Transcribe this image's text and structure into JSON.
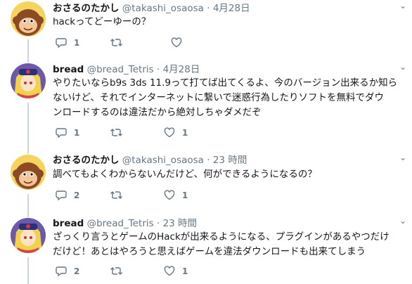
{
  "tweets": [
    {
      "name": "おさるのたかし",
      "handle": "@takashi_osaosa",
      "time": "4月28日",
      "text": "hackってどーゆーの？",
      "replies": "1",
      "retweets": "",
      "likes": "",
      "avatar": "monkey"
    },
    {
      "name": "bread",
      "handle": "@bread_Tetris",
      "time": "4月28日",
      "text": "やりたいならb9s 3ds 11.9って打てば出てくるよ、今のバージョン出来るか知ら\nないけど、それでインターネットに繋いで迷惑行為したりソフトを無料でダウ\nンロードするのは違法だから絶対しちゃダメだぞ",
      "replies": "1",
      "retweets": "",
      "likes": "1",
      "avatar": "anime-girl"
    },
    {
      "name": "おさるのたかし",
      "handle": "@takashi_osaosa",
      "time": "23 時間",
      "text": "調べてもよくわからないんだけど、何ができるようになるの？",
      "replies": "2",
      "retweets": "",
      "likes": "1",
      "avatar": "monkey"
    },
    {
      "name": "bread",
      "handle": "@bread_Tetris",
      "time": "23 時間",
      "text": "ざっくり言うとゲームのHackが出来るようになる、プラグインがあるやつだけ\nだけど！あとはやろうと思えばゲームを違法ダウンロードも出来てしまう",
      "replies": "2",
      "retweets": "",
      "likes": "1",
      "avatar": "anime-girl"
    }
  ],
  "ui": {
    "dot": "·",
    "caret": "⌄"
  },
  "colors": {
    "text": "#14171a",
    "secondary": "#657786",
    "thread_line": "#ccd6dd",
    "separator": "#e6ecf0"
  }
}
